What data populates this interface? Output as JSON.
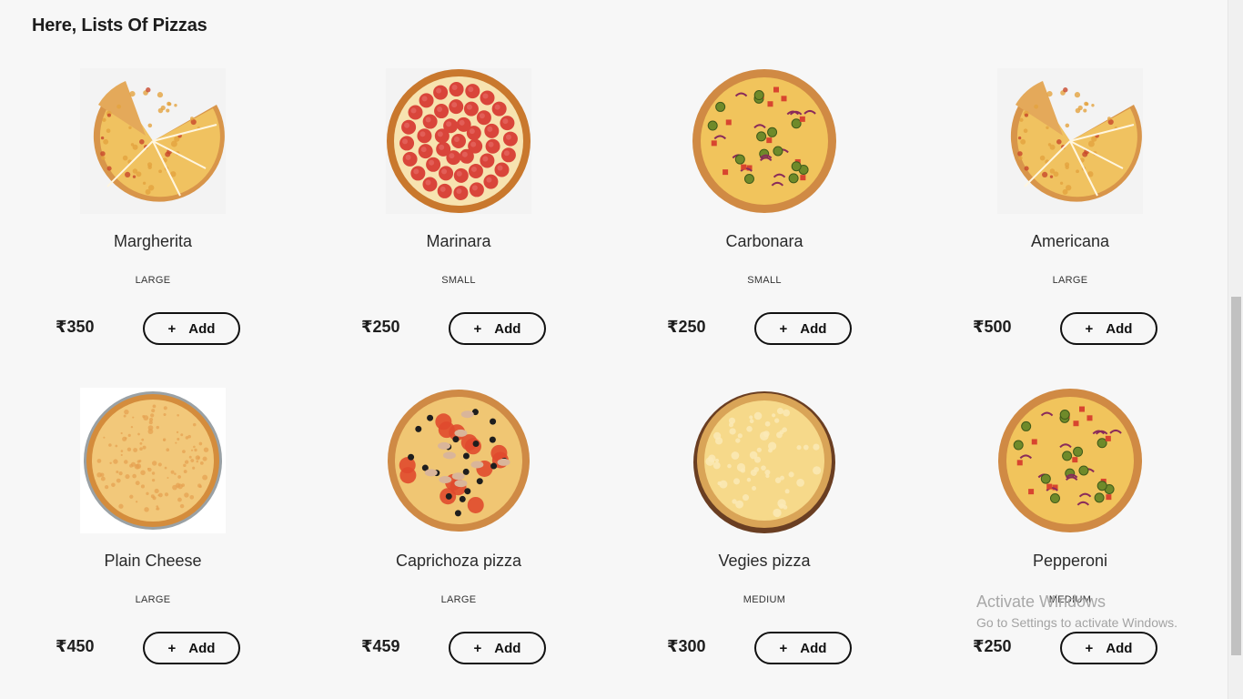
{
  "heading": "Here, Lists Of Pizzas",
  "add_label": "Add",
  "currency": "₹",
  "pizzas": [
    {
      "name": "Margherita",
      "size": "LARGE",
      "price": "₹350",
      "style": "slice-cheese"
    },
    {
      "name": "Marinara",
      "size": "SMALL",
      "price": "₹250",
      "style": "pepperoni"
    },
    {
      "name": "Carbonara",
      "size": "SMALL",
      "price": "₹250",
      "style": "veggie"
    },
    {
      "name": "Americana",
      "size": "LARGE",
      "price": "₹500",
      "style": "slice-cheese"
    },
    {
      "name": "Plain Cheese",
      "size": "LARGE",
      "price": "₹450",
      "style": "cheese-plate"
    },
    {
      "name": "Caprichoza pizza",
      "size": "LARGE",
      "price": "₹459",
      "style": "capricciosa"
    },
    {
      "name": "Vegies pizza",
      "size": "MEDIUM",
      "price": "₹300",
      "style": "white-cheese"
    },
    {
      "name": "Pepperoni",
      "size": "MEDIUM",
      "price": "₹250",
      "style": "veggie"
    }
  ],
  "watermark": {
    "line1": "Activate Windows",
    "line2": "Go to Settings to activate Windows."
  },
  "colors": {
    "background": "#f7f7f7",
    "button_border": "#111111",
    "crust": "#d98b3a",
    "cheese": "#f3c867",
    "pepperoni": "#d9453a"
  }
}
